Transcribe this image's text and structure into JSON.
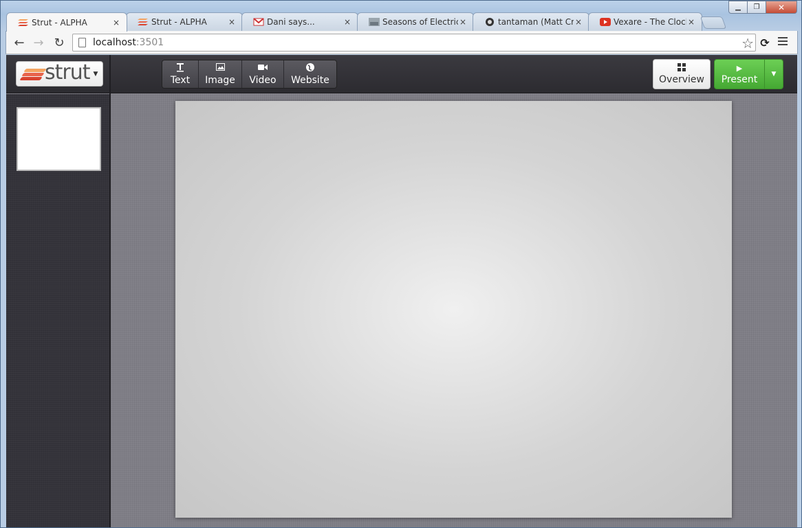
{
  "browser": {
    "tabs": [
      {
        "title": "Strut - ALPHA",
        "favicon": "strut-logo-icon",
        "active": true
      },
      {
        "title": "Strut - ALPHA",
        "favicon": "strut-logo-icon",
        "active": false
      },
      {
        "title": "Dani says...",
        "favicon": "gmail-icon",
        "active": false
      },
      {
        "title": "Seasons of Electricity",
        "favicon": "image-favicon-icon",
        "active": false
      },
      {
        "title": "tantaman (Matt Crinl",
        "favicon": "github-icon",
        "active": false
      },
      {
        "title": "Vexare - The Clockm",
        "favicon": "youtube-icon",
        "active": false
      }
    ],
    "tab_close_glyph": "×",
    "window_controls": {
      "minimize": "▁",
      "restore": "❐",
      "close": "✕"
    },
    "nav": {
      "back": "←",
      "forward": "→",
      "reload": "↻"
    },
    "url": {
      "host": "localhost",
      "port": ":3501"
    },
    "bookmark_glyph": "☆",
    "extension_glyph": "⟳"
  },
  "app": {
    "logo": {
      "text": "strut",
      "caret": "▼"
    },
    "insert_buttons": [
      {
        "label": "Text",
        "icon": "text-icon",
        "glyph": "T̲"
      },
      {
        "label": "Image",
        "icon": "image-icon",
        "glyph": "▣"
      },
      {
        "label": "Video",
        "icon": "video-camera-icon",
        "glyph": "■◂"
      },
      {
        "label": "Website",
        "icon": "globe-icon",
        "glyph": "●"
      }
    ],
    "overview_label": "Overview",
    "present_label": "Present",
    "present_glyph": "▶",
    "present_caret": "▼"
  },
  "colors": {
    "present_green": "#52b83c",
    "header_dark": "#333238",
    "logo_stripes": [
      "#f4a461",
      "#e8634a",
      "#d9432f"
    ]
  }
}
